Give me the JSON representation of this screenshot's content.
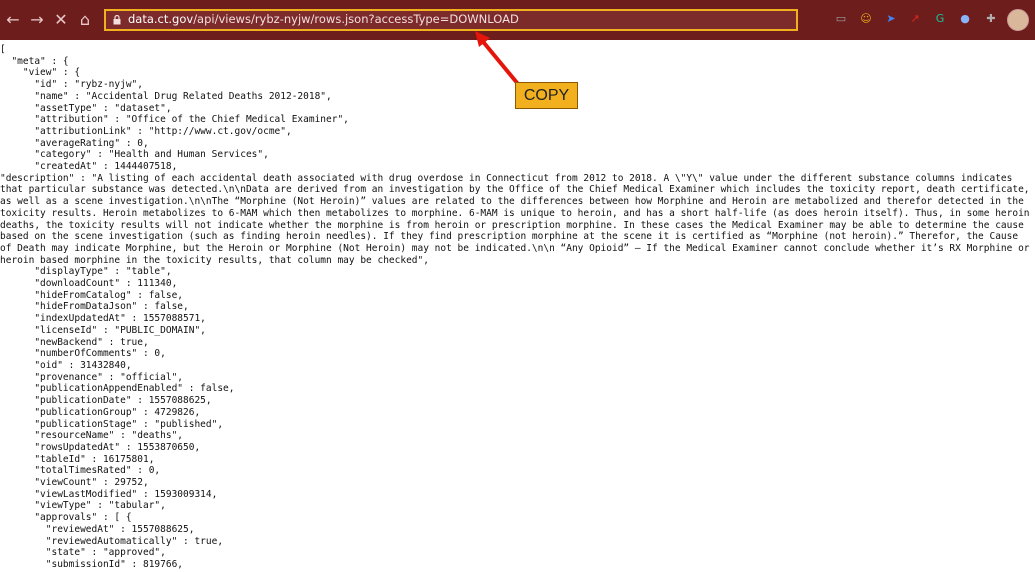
{
  "browser": {
    "url_host": "data.ct.gov",
    "url_path": "/api/views/rybz-nyjw/rows.json?accessType=DOWNLOAD",
    "extensions": [
      {
        "name": "bookmark-star-icon",
        "glyph": "☆",
        "color": "#6e1d1d"
      },
      {
        "name": "cast-icon",
        "glyph": "▭",
        "color": "#9aa0a6"
      },
      {
        "name": "face-extension-icon",
        "glyph": "☺",
        "color": "#e6a817"
      },
      {
        "name": "cursor-extension-icon",
        "glyph": "➤",
        "color": "#4285f4"
      },
      {
        "name": "pdf-extension-icon",
        "glyph": "↗",
        "color": "#e0281b"
      },
      {
        "name": "grammarly-icon",
        "glyph": "G",
        "color": "#15c39a"
      },
      {
        "name": "dropper-extension-icon",
        "glyph": "●",
        "color": "#8ab4f8"
      },
      {
        "name": "puzzle-extensions-icon",
        "glyph": "✚",
        "color": "#b0b0b0"
      }
    ]
  },
  "annotation": {
    "label": "COPY"
  },
  "json_lines_top": [
    "[",
    "  \"meta\" : {",
    "    \"view\" : {",
    "      \"id\" : \"rybz-nyjw\",",
    "      \"name\" : \"Accidental Drug Related Deaths 2012-2018\",",
    "      \"assetType\" : \"dataset\",",
    "      \"attribution\" : \"Office of the Chief Medical Examiner\",",
    "      \"attributionLink\" : \"http://www.ct.gov/ocme\",",
    "      \"averageRating\" : 0,",
    "      \"category\" : \"Health and Human Services\",",
    "      \"createdAt\" : 1444407518,"
  ],
  "description": "      \"description\" : \"A listing of each accidental death associated with drug overdose in Connecticut from 2012 to 2018. A \\\"Y\\\" value under the different substance columns indicates that particular substance was detected.\\n\\nData are derived from an investigation by the Office of the Chief Medical Examiner which includes the toxicity report, death certificate, as well as a scene investigation.\\n\\nThe “Morphine (Not Heroin)” values are related to the differences between how Morphine and Heroin are metabolized and therefor detected in the toxicity results. Heroin metabolizes to 6-MAM which then metabolizes to morphine.  6-MAM is unique to heroin, and has a short half-life (as does heroin itself). Thus, in some heroin deaths, the toxicity results will not indicate whether the morphine is from heroin or prescription morphine. In these cases the Medical Examiner may be able to determine the cause based on the scene investigation (such as  finding heroin needles). If they find prescription morphine at the scene it is certified as “Morphine (not heroin).”  Therefor, the Cause of Death may indicate Morphine, but the Heroin or Morphine (Not Heroin) may not be indicated.\\n\\n “Any Opioid” – If the Medical Examiner cannot conclude whether it’s RX Morphine or heroin based morphine in the toxicity results, that column may be checked\",",
  "json_lines_bottom": [
    "      \"displayType\" : \"table\",",
    "      \"downloadCount\" : 111340,",
    "      \"hideFromCatalog\" : false,",
    "      \"hideFromDataJson\" : false,",
    "      \"indexUpdatedAt\" : 1557088571,",
    "      \"licenseId\" : \"PUBLIC_DOMAIN\",",
    "      \"newBackend\" : true,",
    "      \"numberOfComments\" : 0,",
    "      \"oid\" : 31432840,",
    "      \"provenance\" : \"official\",",
    "      \"publicationAppendEnabled\" : false,",
    "      \"publicationDate\" : 1557088625,",
    "      \"publicationGroup\" : 4729826,",
    "      \"publicationStage\" : \"published\",",
    "      \"resourceName\" : \"deaths\",",
    "      \"rowsUpdatedAt\" : 1553870650,",
    "      \"tableId\" : 16175801,",
    "      \"totalTimesRated\" : 0,",
    "      \"viewCount\" : 29752,",
    "      \"viewLastModified\" : 1593009314,",
    "      \"viewType\" : \"tabular\",",
    "      \"approvals\" : [ {",
    "        \"reviewedAt\" : 1557088625,",
    "        \"reviewedAutomatically\" : true,",
    "        \"state\" : \"approved\",",
    "        \"submissionId\" : 819766,"
  ]
}
